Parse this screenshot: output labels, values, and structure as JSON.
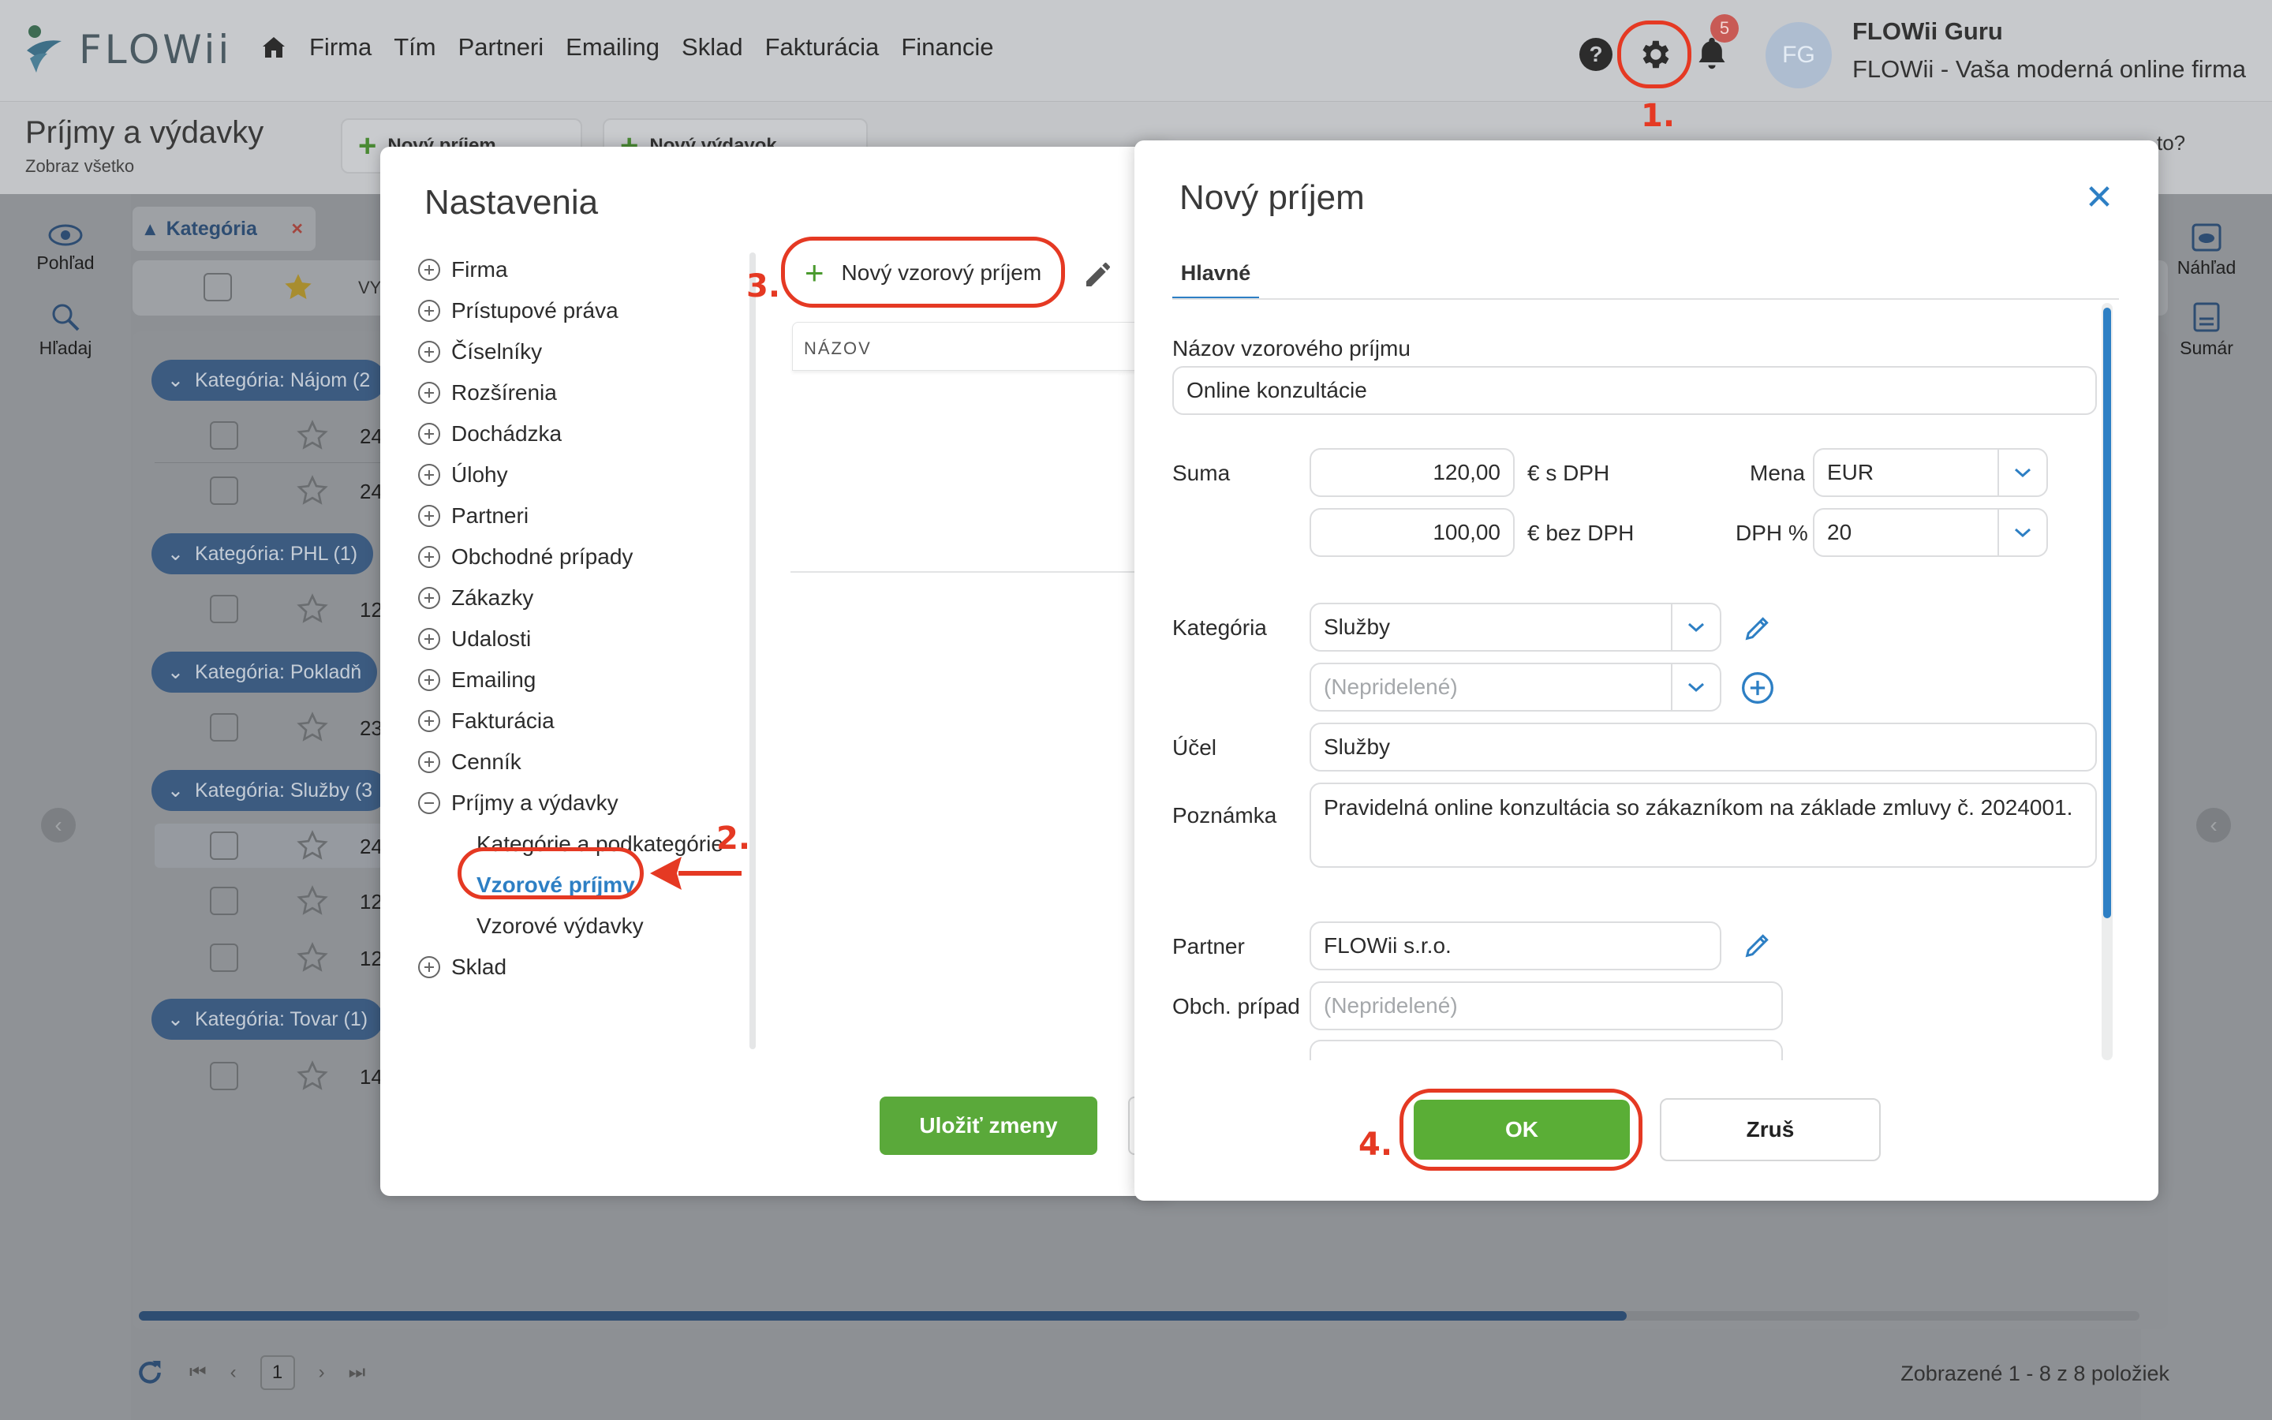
{
  "app": {
    "brand": "FLOWii",
    "nav": [
      "Firma",
      "Tím",
      "Partneri",
      "Emailing",
      "Sklad",
      "Fakturácia",
      "Financie"
    ],
    "notification_count": "5",
    "help_glyph": "?",
    "user": {
      "initials": "FG",
      "name": "FLOWii Guru",
      "company": "FLOWii - Vaša moderná online firma"
    }
  },
  "page": {
    "title": "Príjmy a výdavky",
    "subtitle": "Zobraz všetko",
    "toolbar": {
      "new_income": "Nový príjem",
      "new_expense": "Nový výdavok",
      "help_hint": "to?"
    },
    "sidebar_left": [
      {
        "label": "Pohľad",
        "icon": "eye-icon"
      },
      {
        "label": "Hľadaj",
        "icon": "search-icon"
      }
    ],
    "sidebar_right": [
      {
        "label": "Náhľad",
        "icon": "preview-icon"
      },
      {
        "label": "Sumár",
        "icon": "summary-icon"
      }
    ],
    "filter_chip": "Kategória",
    "filter_chip_remove": "×",
    "header_partial": "VY",
    "groups": [
      {
        "label": "Kategória: Nájom (2",
        "rows": [
          "24",
          "24"
        ]
      },
      {
        "label": "Kategória: PHL (1)",
        "rows": [
          "12"
        ]
      },
      {
        "label": "Kategória: Pokladň",
        "rows": [
          "23"
        ]
      },
      {
        "label": "Kategória: Služby (3",
        "rows": [
          "24",
          "12",
          "12"
        ]
      },
      {
        "label": "Kategória: Tovar (1)",
        "rows": [
          "14"
        ]
      }
    ],
    "pager": {
      "current": "1"
    },
    "footer_count": "Zobrazené 1 - 8 z 8 položiek"
  },
  "settings": {
    "title": "Nastavenia",
    "tree": [
      "Firma",
      "Prístupové práva",
      "Číselníky",
      "Rozšírenia",
      "Dochádzka",
      "Úlohy",
      "Partneri",
      "Obchodné prípady",
      "Zákazky",
      "Udalosti",
      "Emailing",
      "Fakturácia",
      "Cenník",
      "Príjmy a výdavky"
    ],
    "subitems": [
      "Kategórie a podkategórie",
      "Vzorové príjmy",
      "Vzorové výdavky"
    ],
    "last_item": "Sklad",
    "new_template_button": "Nový vzorový príjem",
    "column_header": "NÁZOV",
    "save_button": "Uložiť zmeny"
  },
  "dialog": {
    "title": "Nový príjem",
    "tab": "Hlavné",
    "template_name_label": "Názov vzorového príjmu",
    "template_name_value": "Online konzultácie",
    "sum_label": "Suma",
    "sum_with_vat": "120,00",
    "sum_with_vat_unit": "€ s DPH",
    "sum_without_vat": "100,00",
    "sum_without_vat_unit": "€ bez DPH",
    "currency_label": "Mena",
    "currency_value": "EUR",
    "vat_label": "DPH %",
    "vat_value": "20",
    "category_label": "Kategória",
    "category_value": "Služby",
    "subcategory_placeholder": "(Nepridelené)",
    "purpose_label": "Účel",
    "purpose_value": "Služby",
    "note_label": "Poznámka",
    "note_value": "Pravidelná online konzultácia so zákazníkom na základe zmluvy č. 2024001.",
    "partner_label": "Partner",
    "partner_value": "FLOWii s.r.o.",
    "business_case_label": "Obch. prípad",
    "business_case_placeholder": "(Nepridelené)",
    "ok_button": "OK",
    "cancel_button": "Zruš"
  },
  "annotations": [
    "1.",
    "2.",
    "3.",
    "4."
  ],
  "colors": {
    "accent_blue": "#2d7fc4",
    "ok_green": "#5aae36",
    "annotation_red": "#e53923"
  }
}
